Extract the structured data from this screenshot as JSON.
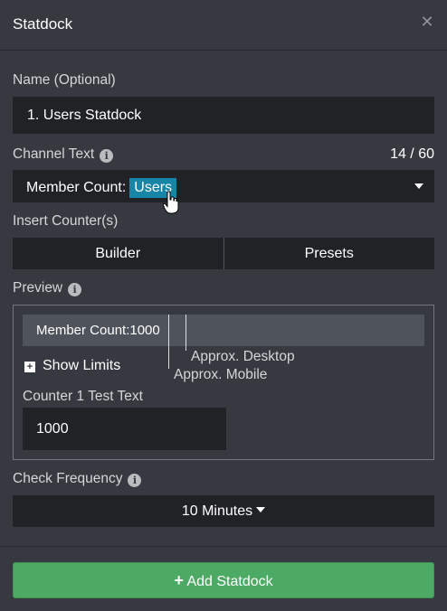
{
  "header": {
    "title": "Statdock",
    "close_icon": "close-icon"
  },
  "name_field": {
    "label": "Name (Optional)",
    "value": "1. Users Statdock"
  },
  "channel_text": {
    "label": "Channel Text",
    "char_count": "14 / 60",
    "prefix": "Member Count:",
    "chip": "Users",
    "chip_color": "#1685a8"
  },
  "insert_counters": {
    "label": "Insert Counter(s)",
    "builder": "Builder",
    "presets": "Presets"
  },
  "preview": {
    "label": "Preview",
    "text": "Member Count:1000",
    "desktop_label": "Approx. Desktop",
    "mobile_label": "Approx. Mobile",
    "show_limits": "Show Limits",
    "test_label": "Counter 1 Test Text",
    "test_value": "1000"
  },
  "check_frequency": {
    "label": "Check Frequency",
    "value": "10 Minutes"
  },
  "footer": {
    "add_button": "Add Statdock",
    "accent": "#4caa64"
  }
}
